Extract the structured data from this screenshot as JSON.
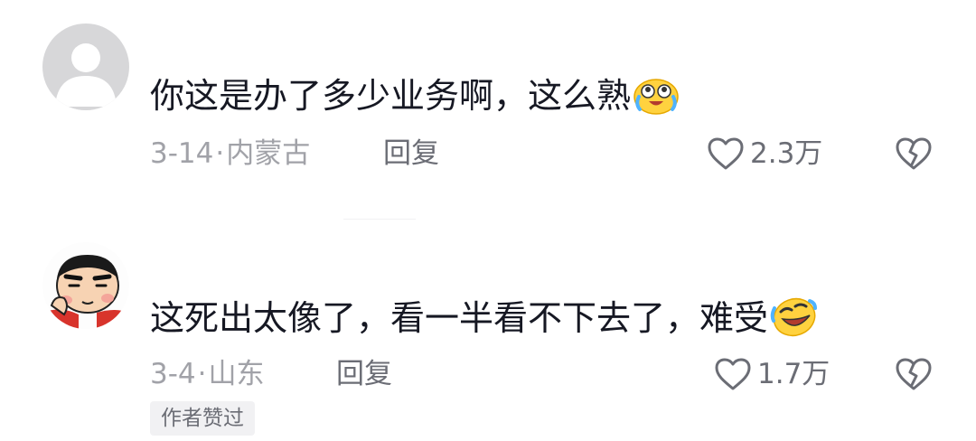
{
  "comments": [
    {
      "avatar_icon": "default-user-avatar-icon",
      "text": "你这是办了多少业务啊，这么熟",
      "emoji_icon": "laughing-tears-emoji-icon",
      "date": "3-14",
      "separator": "·",
      "location": "内蒙古",
      "reply_label": "回复",
      "like_count": "2.3万",
      "like_icon": "heart-outline-icon",
      "dislike_icon": "broken-heart-icon"
    },
    {
      "avatar_icon": "cartoon-boy-avatar-icon",
      "text": "这死出太像了，看一半看不下去了，难受",
      "emoji_icon": "rolling-laughing-emoji-icon",
      "date": "3-4",
      "separator": "·",
      "location": "山东",
      "reply_label": "回复",
      "like_count": "1.7万",
      "like_icon": "heart-outline-icon",
      "dislike_icon": "broken-heart-icon",
      "badge": "作者赞过"
    }
  ],
  "colors": {
    "text_primary": "#161823",
    "text_meta": "#a1a2a8",
    "text_secondary": "#6b6d75",
    "badge_bg": "#f1f1f3"
  }
}
